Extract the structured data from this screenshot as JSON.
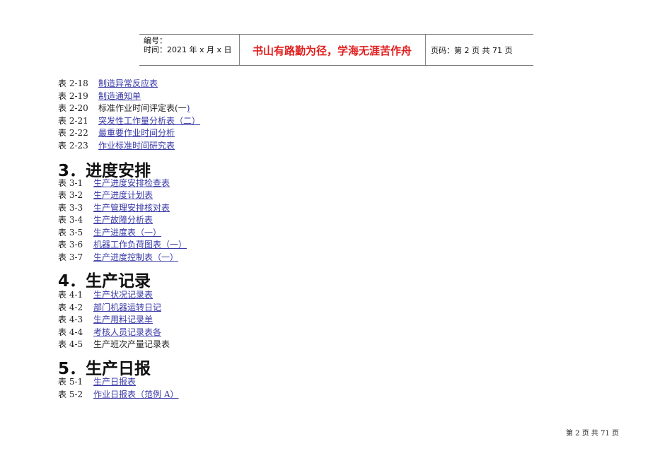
{
  "header": {
    "number_label": "编号：",
    "time_label": "时间：2021 年 x 月 x 日",
    "motto": "书山有路勤为径，学海无涯苦作舟",
    "page_info": "页码：第 2 页 共 71 页"
  },
  "sections": [
    {
      "items": [
        {
          "label": "表 2-18",
          "text": "",
          "link": "制造异常反应表"
        },
        {
          "label": "表 2-19",
          "text": "",
          "link": "制造通知单"
        },
        {
          "label": "表 2-20",
          "text": "标准作业时间评定表(一",
          "link": ")"
        },
        {
          "label": "表 2-21",
          "text": "",
          "link": "突发性工作量分析表（二）"
        },
        {
          "label": "表 2-22",
          "text": "",
          "link": "最重要作业时间分析"
        },
        {
          "label": "表 2-23",
          "text": "",
          "link": "作业标准时间研究表"
        }
      ]
    },
    {
      "heading": "3．进度安排",
      "items": [
        {
          "label": "表 3-1",
          "text": "",
          "link": "生产进度安排检查表"
        },
        {
          "label": "表 3-2",
          "text": "",
          "link": "生产进度计划表"
        },
        {
          "label": "表 3-3",
          "text": "",
          "link": "生产管理安排核对表"
        },
        {
          "label": "表 3-4",
          "text": "",
          "link": "生产故障分析表"
        },
        {
          "label": "表 3-5",
          "text": "",
          "link": "生产进度表（一）"
        },
        {
          "label": "表 3-6",
          "text": "",
          "link": "机器工作负荷图表（一）"
        },
        {
          "label": "表 3-7",
          "text": "",
          "link": "生产进度控制表（一）"
        }
      ]
    },
    {
      "heading": "4．生产记录",
      "items": [
        {
          "label": "表 4-1",
          "text": "",
          "link": "生产状况记录表"
        },
        {
          "label": "表 4-2",
          "text": "",
          "link": "部门机器运转日记"
        },
        {
          "label": "表 4-3",
          "text": "",
          "link": "生产用料记录单"
        },
        {
          "label": "表 4-4",
          "text": "",
          "link": "考核人员记录表各 "
        },
        {
          "label": "表 4-5",
          "text": "生产班次产量记录表",
          "link": ""
        }
      ]
    },
    {
      "heading": "5．生产日报",
      "items": [
        {
          "label": "表 5-1",
          "text": "",
          "link": "生产日报表"
        },
        {
          "label": "表 5-2",
          "text": "",
          "link": "作业日报表（范例 A）"
        }
      ]
    }
  ],
  "footer": "第 2 页 共 71 页"
}
